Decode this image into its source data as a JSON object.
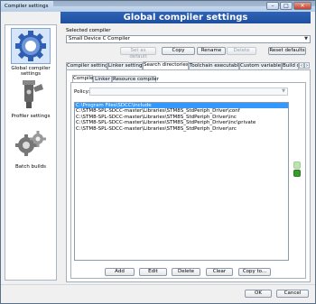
{
  "window": {
    "title": "Compiler settings"
  },
  "header": {
    "title": "Global compiler settings"
  },
  "sidebar": {
    "items": [
      {
        "label": "Global compiler settings",
        "icon": "gear-icon",
        "selected": true
      },
      {
        "label": "Profiler settings",
        "icon": "profiler-icon",
        "selected": false
      },
      {
        "label": "Batch builds",
        "icon": "batch-gears-icon",
        "selected": false
      }
    ]
  },
  "compiler": {
    "selected_label": "Selected compiler",
    "selected_value": "Small Device C Compiler",
    "buttons": {
      "set_default": "Set as default",
      "copy": "Copy",
      "rename": "Rename",
      "delete": "Delete",
      "reset": "Reset defaults"
    }
  },
  "tabs": [
    "Compiler settings",
    "Linker settings",
    "Search directories",
    "Toolchain executables",
    "Custom variables",
    "Build o"
  ],
  "subtabs": [
    "Compiler",
    "Linker",
    "Resource compiler"
  ],
  "policy": {
    "label": "Policy:",
    "value": ""
  },
  "directories": [
    "C:\\Program Files\\SDCC\\include",
    "C:\\STM8-SPL-SDCC-master\\Libraries\\STM8S_StdPeriph_Driver\\conf",
    "C:\\STM8-SPL-SDCC-master\\Libraries\\STM8S_StdPeriph_Driver\\inc",
    "C:\\STM8-SPL-SDCC-master\\Libraries\\STM8S_StdPeriph_Driver\\inc\\private",
    "C:\\STM8-SPL-SDCC-master\\Libraries\\STM8S_StdPeriph_Driver\\src"
  ],
  "list_buttons": {
    "add": "Add",
    "edit": "Edit",
    "delete": "Delete",
    "clear": "Clear",
    "copy_to": "Copy to..."
  },
  "dialog_buttons": {
    "ok": "OK",
    "cancel": "Cancel"
  },
  "colors": {
    "header": "#2e63b8",
    "selection": "#3399ff"
  }
}
